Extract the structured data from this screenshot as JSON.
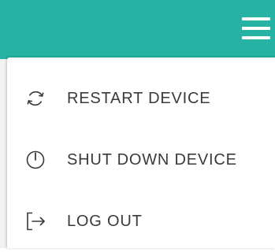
{
  "header": {
    "menu_icon": "hamburger-menu-icon",
    "accent_color": "#26b3a3"
  },
  "menu": {
    "items": [
      {
        "label": "RESTART DEVICE",
        "icon": "restart-icon"
      },
      {
        "label": "SHUT DOWN DEVICE",
        "icon": "power-icon"
      },
      {
        "label": "LOG OUT",
        "icon": "logout-icon"
      }
    ]
  }
}
